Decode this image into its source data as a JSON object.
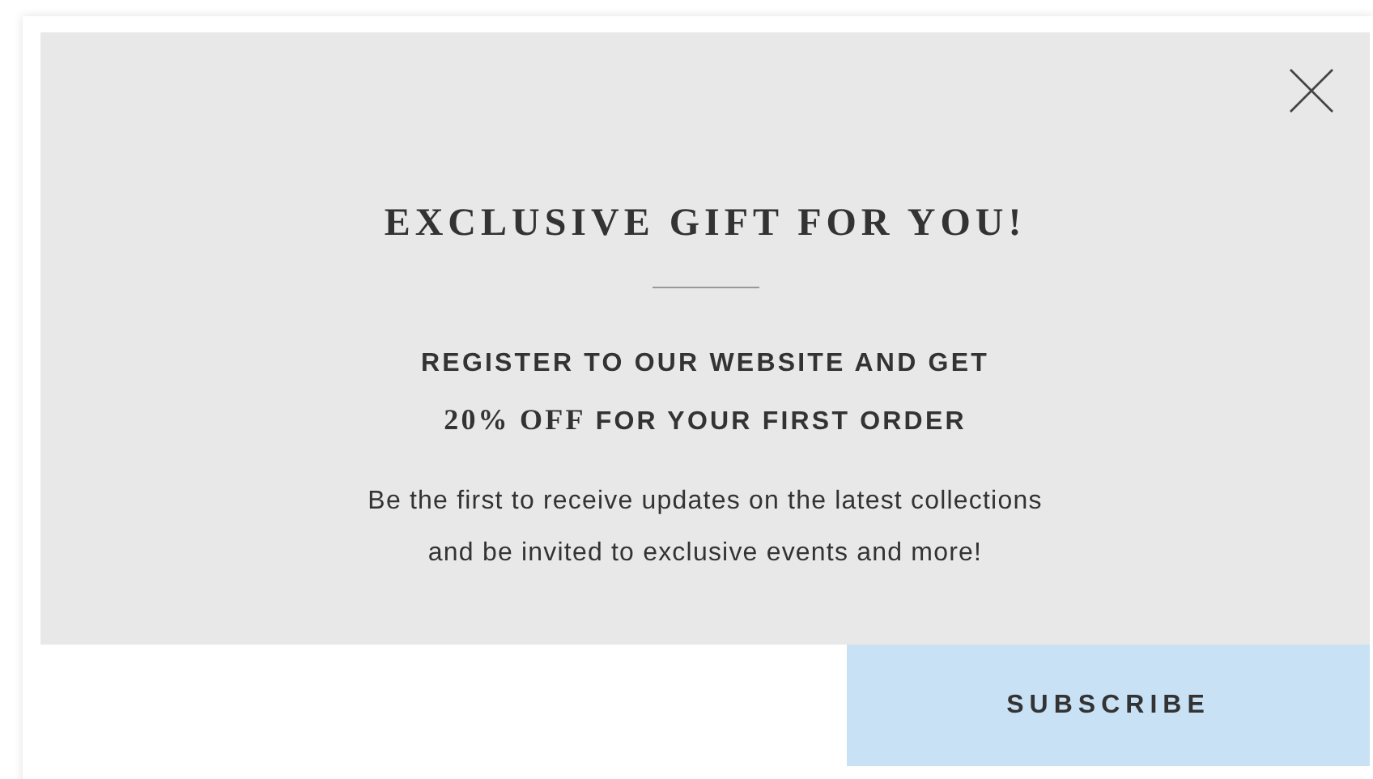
{
  "popup": {
    "title": "EXCLUSIVE GIFT FOR YOU!",
    "offer_lines": [
      "REGISTER TO OUR WEBSITE AND GET",
      "**20% OFF** FOR YOUR FIRST ORDER"
    ],
    "description_lines": [
      "Be the first to receive updates on the latest collections",
      "and be invited to exclusive events and more!"
    ],
    "subscribe_button": "SUBSCRIBE"
  }
}
